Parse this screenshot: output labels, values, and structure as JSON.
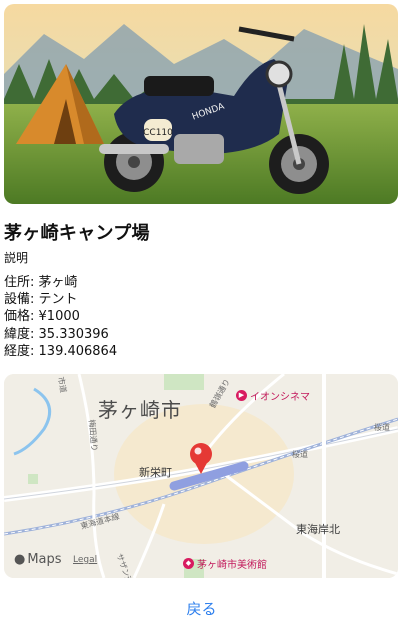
{
  "campsite": {
    "name": "茅ヶ崎キャンプ場",
    "description_label": "説明",
    "details": [
      {
        "label": "住所",
        "value": "茅ヶ崎"
      },
      {
        "label": "設備",
        "value": "テント"
      },
      {
        "label": "価格",
        "value": "¥1000"
      },
      {
        "label": "緯度",
        "value": "35.330396"
      },
      {
        "label": "経度",
        "value": "139.406864"
      }
    ]
  },
  "photo": {
    "alt": "motorcycle-and-tent-photo",
    "plate_text": "CC110",
    "brand_text": "HONDA"
  },
  "map": {
    "city_label": "茅ヶ崎市",
    "area_labels": {
      "shineicho": "新栄町",
      "tokai_kishi_kita": "東海岸北"
    },
    "poi_labels": {
      "cinema": "イオンシネマ",
      "museum": "茅ヶ崎市美術館"
    },
    "road_labels": {
      "road1": "市道",
      "road2": "梅田通り",
      "road3": "東海道本線",
      "road4": "鶴嶺通り",
      "road5": "桜道",
      "road6": "サザン通り",
      "road7": "桜道"
    },
    "maps_brand": "Maps",
    "legal_label": "Legal",
    "accent_pin_color": "#e53935"
  },
  "actions": {
    "back_label": "戻る"
  },
  "colors": {
    "accent_blue": "#2f80ed"
  }
}
